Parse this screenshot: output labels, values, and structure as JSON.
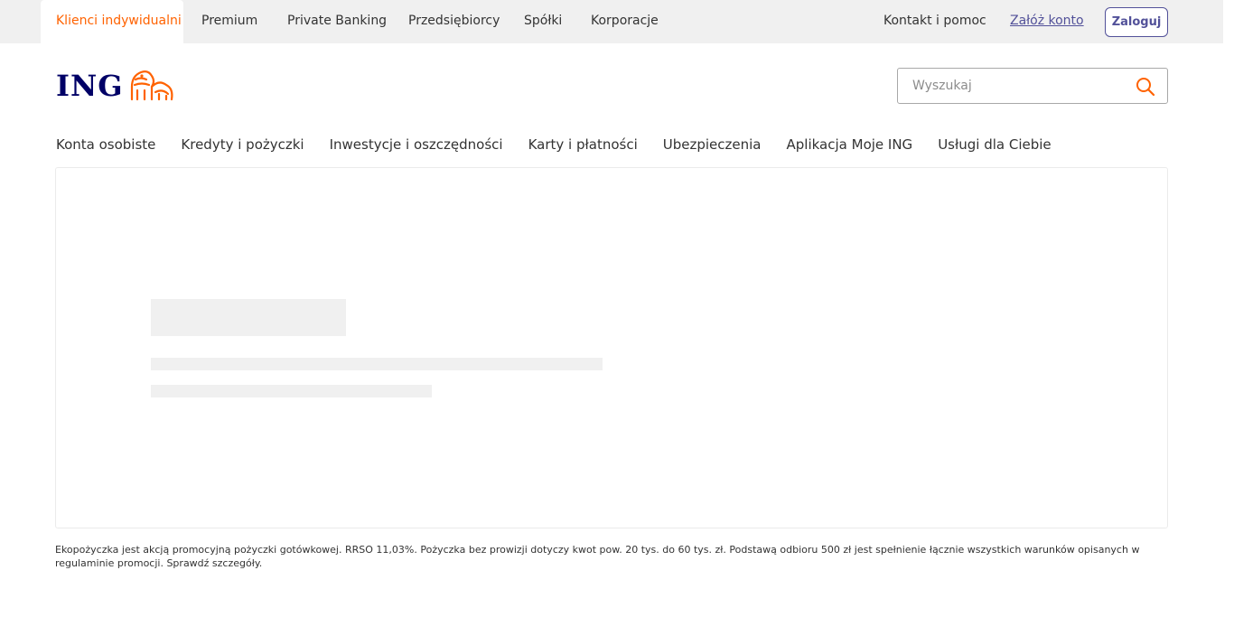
{
  "topbar": {
    "segments": [
      {
        "label": "Klienci indywidualni",
        "active": true
      },
      {
        "label": "Premium"
      },
      {
        "label": "Private Banking"
      },
      {
        "label": "Przedsiębiorcy"
      },
      {
        "label": "Spółki"
      },
      {
        "label": "Korporacje"
      }
    ],
    "contact_label": "Kontakt i pomoc",
    "open_account_label": "Załóż konto",
    "login_label": "Zaloguj"
  },
  "brand": {
    "logo_text": "ING",
    "logo_color": "#000066",
    "accent": "#ff6200",
    "link_color": "#525199"
  },
  "search": {
    "placeholder": "Wyszukaj",
    "value": ""
  },
  "mainnav": {
    "items": [
      {
        "label": "Konta osobiste"
      },
      {
        "label": "Kredyty i pożyczki"
      },
      {
        "label": "Inwestycje i oszczędności"
      },
      {
        "label": "Karty i płatności"
      },
      {
        "label": "Ubezpieczenia"
      },
      {
        "label": "Aplikacja Moje ING"
      },
      {
        "label": "Usługi dla Ciebie"
      }
    ]
  },
  "disclaimer": {
    "text": "Ekopożyczka jest akcją promocyjną pożyczki gotówkowej. RRSO 11,03%. Pożyczka bez prowizji dotyczy kwot pow. 20 tys. do 60 tys. zł. Podstawą odbioru 500 zł jest spełnienie łącznie wszystkich warunków opisanych w regulaminie promocji. Sprawdź szczegóły."
  },
  "icons": {
    "search": "search-icon",
    "logo_lion": "lion-logo-icon"
  }
}
